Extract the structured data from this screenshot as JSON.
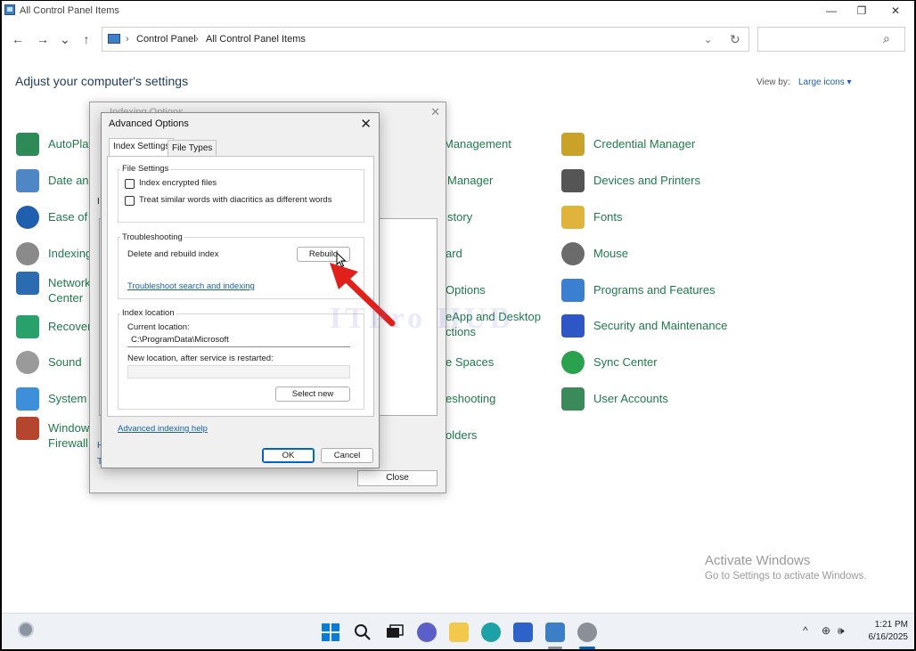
{
  "window": {
    "title": "All Control Panel Items",
    "minimize": "—",
    "restore": "❐",
    "close": "✕"
  },
  "nav": {
    "back": "←",
    "forward": "→",
    "recent": "⌄",
    "up": "↑",
    "breadcrumb": [
      "Control Panel",
      "All Control Panel Items"
    ],
    "sep": "›",
    "dropdown": "⌄",
    "refresh": "↻",
    "search_placeholder": "",
    "search_icon": "⌕"
  },
  "main": {
    "heading": "Adjust your computer's settings",
    "view_by_label": "View by:",
    "view_by_value": "Large icons ▾"
  },
  "items": {
    "col1": [
      {
        "label": "AutoPlay",
        "icon": "autoplay-icon",
        "color": "#2e8b57"
      },
      {
        "label": "Date and",
        "icon": "date-time-icon",
        "color": "#4f86c6"
      },
      {
        "label": "Ease of A",
        "icon": "ease-of-access-icon",
        "color": "#1f5fae"
      },
      {
        "label": "Indexing",
        "icon": "indexing-options-icon",
        "color": "#8a8a8a"
      },
      {
        "label": "Network\nCenter",
        "icon": "network-icon",
        "color": "#2b6cb0"
      },
      {
        "label": "Recover",
        "icon": "recovery-icon",
        "color": "#2aa06a"
      },
      {
        "label": "Sound",
        "icon": "sound-icon",
        "color": "#9a9a9a"
      },
      {
        "label": "System",
        "icon": "system-icon",
        "color": "#3c8fd8"
      },
      {
        "label": "Window\nFirewall",
        "icon": "firewall-icon",
        "color": "#b5462e"
      }
    ],
    "col2": [
      {
        "label": "Management"
      },
      {
        "label": "Manager"
      },
      {
        "label": "story"
      },
      {
        "label": "ard"
      },
      {
        "label": "Options"
      },
      {
        "label": "eApp and Desktop\nctions"
      },
      {
        "label": "e Spaces"
      },
      {
        "label": "eshooting"
      },
      {
        "label": "olders"
      }
    ],
    "col3": [
      {
        "label": "Credential Manager",
        "icon": "credential-manager-icon",
        "color": "#c9a227"
      },
      {
        "label": "Devices and Printers",
        "icon": "printer-icon",
        "color": "#555555"
      },
      {
        "label": "Fonts",
        "icon": "fonts-icon",
        "color": "#e0b43a"
      },
      {
        "label": "Mouse",
        "icon": "mouse-icon",
        "color": "#6b6b6b"
      },
      {
        "label": "Programs and Features",
        "icon": "programs-icon",
        "color": "#3b7fd1"
      },
      {
        "label": "Security and Maintenance",
        "icon": "security-flag-icon",
        "color": "#2f56c5"
      },
      {
        "label": "Sync Center",
        "icon": "sync-icon",
        "color": "#2aa14e"
      },
      {
        "label": "User Accounts",
        "icon": "user-accounts-icon",
        "color": "#3a8a5c"
      }
    ]
  },
  "indexing_dialog": {
    "title": "Indexing Options",
    "close": "✕",
    "peek_i": "I",
    "peek_h": "H",
    "peek_t": "T",
    "close_button": "Close"
  },
  "advanced": {
    "title": "Advanced Options",
    "close": "✕",
    "tabs": [
      "Index Settings",
      "File Types"
    ],
    "file_settings": {
      "title": "File Settings",
      "opt1": "Index encrypted files",
      "opt2": "Treat similar words with diacritics as different words"
    },
    "troubleshooting": {
      "title": "Troubleshooting",
      "delete_rebuild": "Delete and rebuild index",
      "rebuild_button": "Rebuild",
      "link": "Troubleshoot search and indexing"
    },
    "index_location": {
      "title": "Index location",
      "current_label": "Current location:",
      "current_value": "C:\\ProgramData\\Microsoft",
      "new_label": "New location, after service is restarted:",
      "new_value": "",
      "select_new": "Select new"
    },
    "help_link": "Advanced indexing help",
    "ok": "OK",
    "cancel": "Cancel"
  },
  "overlay": {
    "watermark": "ITPro HUB",
    "activate_title": "Activate Windows",
    "activate_sub": "Go to Settings to activate Windows."
  },
  "taskbar": {
    "time": "1:21 PM",
    "date": "6/16/2025",
    "chevron": "^",
    "globe": "⊕",
    "speaker": "🕪"
  },
  "colors": {
    "link_green": "#1f7a4a",
    "accent_blue": "#0067c0",
    "arrow_red": "#e0201b"
  }
}
